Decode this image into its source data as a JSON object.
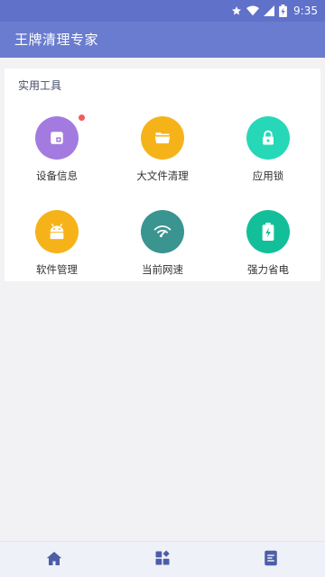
{
  "status_bar": {
    "time": "9:35",
    "icons": [
      "star-icon",
      "wifi-icon",
      "signal-icon",
      "battery-icon"
    ]
  },
  "app_bar": {
    "title": "王牌清理专家"
  },
  "tools_section": {
    "title": "实用工具",
    "items": [
      {
        "label": "设备信息",
        "icon": "device-info-icon",
        "color": "#a37be0",
        "has_badge": true
      },
      {
        "label": "大文件清理",
        "icon": "folder-icon",
        "color": "#f6b319",
        "has_badge": false
      },
      {
        "label": "应用锁",
        "icon": "lock-icon",
        "color": "#26d8b8",
        "has_badge": false
      },
      {
        "label": "软件管理",
        "icon": "android-icon",
        "color": "#f6b319",
        "has_badge": false
      },
      {
        "label": "当前网速",
        "icon": "wifi-speed-icon",
        "color": "#3a9490",
        "has_badge": false
      },
      {
        "label": "强力省电",
        "icon": "battery-save-icon",
        "color": "#12bf98",
        "has_badge": false
      }
    ]
  },
  "bottom_nav": {
    "items": [
      {
        "icon": "home-icon",
        "active": true
      },
      {
        "icon": "apps-icon",
        "active": false
      },
      {
        "icon": "document-icon",
        "active": false
      }
    ]
  },
  "colors": {
    "status_bar": "#5f71c9",
    "app_bar": "#6a7ccf",
    "nav_icon": "#4d5ea8",
    "badge": "#f25c5c"
  }
}
